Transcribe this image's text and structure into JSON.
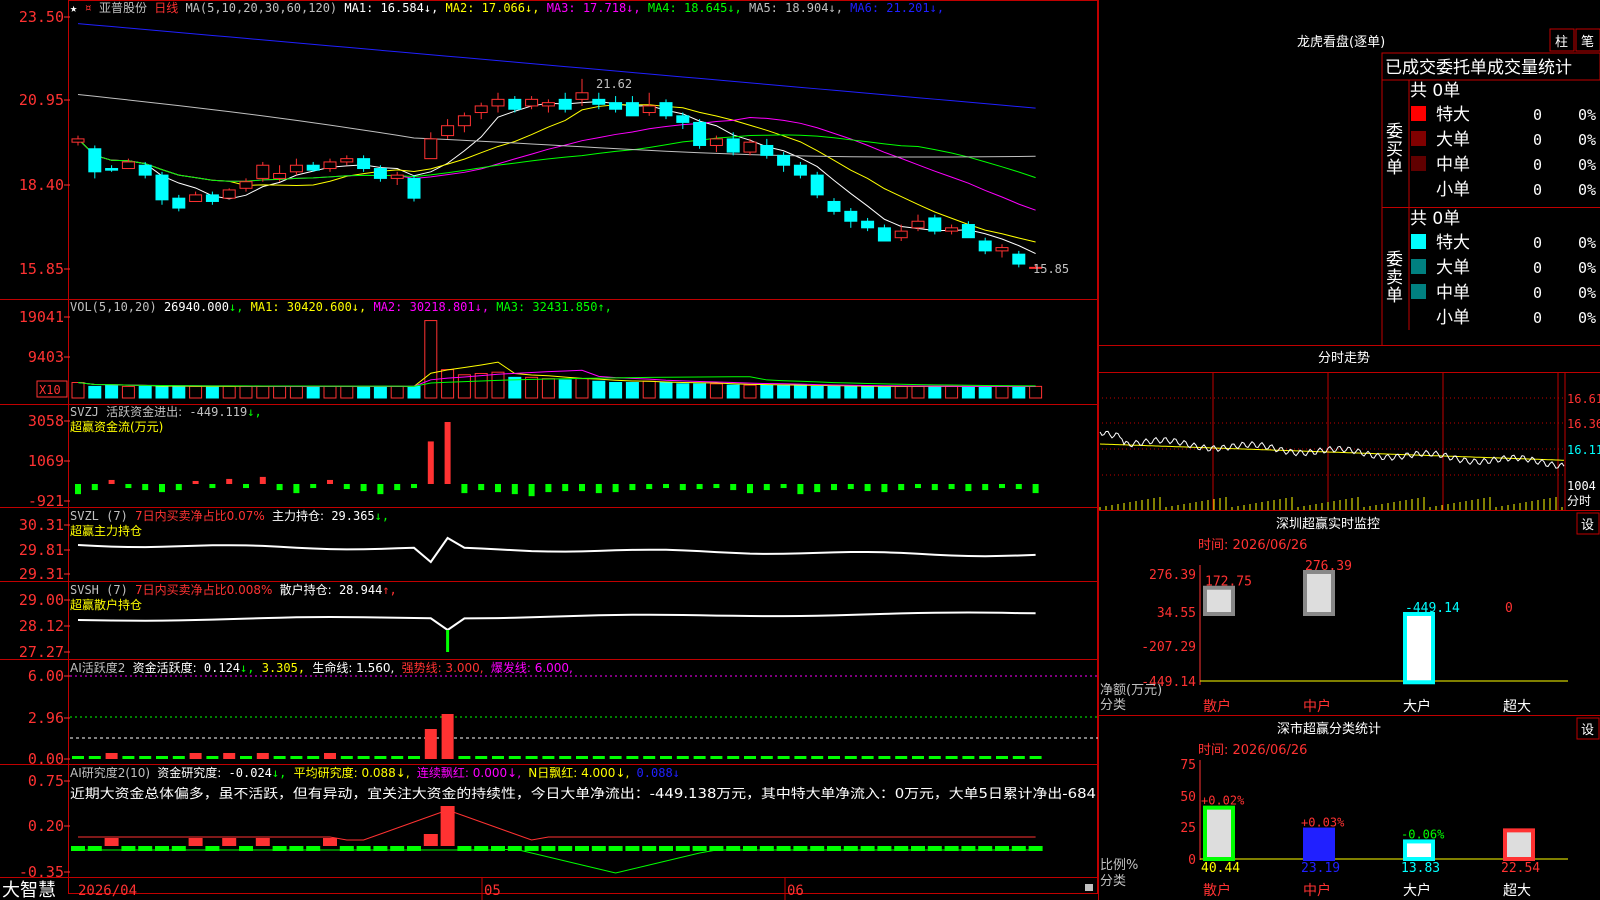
{
  "stock": {
    "name": "亚普股份",
    "period": "日线"
  },
  "main_panel": {
    "ma_header": "MA(5,10,20,30,60,120)",
    "ma_values": [
      {
        "label": "MA1:",
        "value": "16.584",
        "arrow": "↓",
        "color": "#ffffff"
      },
      {
        "label": "MA2:",
        "value": "17.066",
        "arrow": "↓",
        "color": "#ffff00"
      },
      {
        "label": "MA3:",
        "value": "17.718",
        "arrow": "↓",
        "color": "#ff00ff"
      },
      {
        "label": "MA4:",
        "value": "18.645",
        "arrow": "↓",
        "color": "#00ff00"
      },
      {
        "label": "MA5:",
        "value": "18.904",
        "arrow": "↓",
        "color": "#c0c0c0"
      },
      {
        "label": "MA6:",
        "value": "21.201",
        "arrow": "↓",
        "color": "#2020ff"
      }
    ],
    "y_ticks": [
      "23.50",
      "20.95",
      "18.40",
      "15.85"
    ],
    "high_label": "21.62",
    "low_label": "15.85"
  },
  "vol_panel": {
    "header": "VOL(5,10,20)",
    "value": "26940.000",
    "ma": [
      {
        "label": "MA1:",
        "value": "30420.600",
        "arrow": "↓",
        "color": "#ffff00"
      },
      {
        "label": "MA2:",
        "value": "30218.801",
        "arrow": "↓",
        "color": "#ff00ff"
      },
      {
        "label": "MA3:",
        "value": "32431.850",
        "arrow": "↑",
        "color": "#00ff00"
      }
    ],
    "y_ticks": [
      "19041",
      "9403"
    ],
    "unit": "X10"
  },
  "svzj": {
    "name": "SVZJ",
    "label": "活跃资金进出:",
    "value": "-449.119",
    "arrow": "↓,",
    "subtitle": "超赢资金流(万元)",
    "y_ticks": [
      "3058",
      "1069",
      "-921"
    ]
  },
  "svzl": {
    "name": "SVZL (7)",
    "ratio": "7日内买卖净占比0.07%",
    "label": "主力持仓:",
    "value": "29.365",
    "arrow": "↓,",
    "subtitle": "超赢主力持仓",
    "y_ticks": [
      "30.31",
      "29.81",
      "29.31"
    ]
  },
  "svsh": {
    "name": "SVSH (7)",
    "ratio": "7日内买卖净占比0.008%",
    "label": "散户持仓:",
    "value": "28.944",
    "arrow": "↑,",
    "subtitle": "超赢散户持仓",
    "y_ticks": [
      "29.00",
      "28.12",
      "27.27"
    ]
  },
  "ai_active": {
    "name": "AI活跃度2",
    "label": "资金活跃度:",
    "value": "0.124",
    "arrow": "↓,",
    "v2": "3.305,",
    "life": "生命线: 1.560,",
    "strong": "强势线: 3.000,",
    "burst": "爆发线: 6.000,",
    "y_ticks": [
      "6.00",
      "2.96",
      "0.00"
    ]
  },
  "ai_research": {
    "name": "AI研究度2(10)",
    "label": "资金研究度:",
    "value": "-0.024",
    "arrow": "↓,",
    "avg": "平均研究度: 0.088↓,",
    "red": "连续飘红: 0.000↓,",
    "nred": "N日飘红: 4.000↓,",
    "last": "0.088↓",
    "comment": "近期大资金总体偏多，虽不活跃，但有异动，宜关注大资金的持续性，今日大单净流出：-449.138万元，其中特大单净流入：0万元，大单5日累计净出-684",
    "y_ticks": [
      "0.75",
      "0.20",
      "-0.35"
    ]
  },
  "bottom": {
    "brand": "大智慧",
    "date_start": "2026/04",
    "month2": "05",
    "month3": "06"
  },
  "dragon": {
    "title": "龙虎看盘(逐单)",
    "btn1": "柱",
    "btn2": "笔",
    "tabs": "已成交委托单成交量统计",
    "buy": {
      "label": "委买单",
      "total": "共 0单",
      "rows": [
        {
          "name": "特大",
          "count": "0",
          "pct": "0%",
          "color": "#ff0000"
        },
        {
          "name": "大单",
          "count": "0",
          "pct": "0%",
          "color": "#800000"
        },
        {
          "name": "中单",
          "count": "0",
          "pct": "0%",
          "color": "#600000"
        },
        {
          "name": "小单",
          "count": "0",
          "pct": "0%",
          "color": ""
        }
      ]
    },
    "sell": {
      "label": "委卖单",
      "total": "共 0单",
      "rows": [
        {
          "name": "特大",
          "count": "0",
          "pct": "0%",
          "color": "#00ffff"
        },
        {
          "name": "大单",
          "count": "0",
          "pct": "0%",
          "color": "#008080"
        },
        {
          "name": "中单",
          "count": "0",
          "pct": "0%",
          "color": "#008080"
        },
        {
          "name": "小单",
          "count": "0",
          "pct": "0%",
          "color": ""
        }
      ]
    }
  },
  "intraday": {
    "title": "分时走势",
    "prices": [
      "16.61",
      "16.36",
      "16.11"
    ],
    "vol": "1004",
    "vol_label": "分时"
  },
  "monitor": {
    "title": "深圳超赢实时监控",
    "set": "设",
    "time": "时间: 2026/06/26",
    "y_ticks": [
      "276.39",
      "34.55",
      "-207.29",
      "-449.14"
    ],
    "y_unit": "净额(万元)",
    "x_unit": "分类",
    "categories": [
      "散户",
      "中户",
      "大户",
      "超大"
    ],
    "values": [
      172.75,
      276.39,
      -449.14,
      0
    ],
    "value_labels": [
      "172.75",
      "276.39",
      "-449.14",
      "0"
    ]
  },
  "classify": {
    "title": "深市超赢分类统计",
    "set": "设",
    "time": "时间: 2026/06/26",
    "y_ticks": [
      "75",
      "50",
      "25",
      "0"
    ],
    "y_unit": "比例%",
    "x_unit": "分类",
    "categories": [
      "散户",
      "中户",
      "大户",
      "超大"
    ],
    "values": [
      40.44,
      23.19,
      13.83,
      22.54
    ],
    "value_labels": [
      "40.44",
      "23.19",
      "13.83",
      "22.54"
    ],
    "change_labels": [
      "+0.02%",
      "+0.03%",
      "-0.06%",
      ""
    ]
  },
  "colors": {
    "up": "#ff3232",
    "down": "#00ffff",
    "grid": "#c00000",
    "text_red": "#ff3232"
  },
  "chart_data": {
    "type": "candlestick",
    "title": "亚普股份 日线",
    "x_months": [
      "2026/04",
      "05",
      "06"
    ],
    "ylim": [
      15.0,
      23.5
    ],
    "ohlc": [
      [
        19.7,
        19.9,
        19.6,
        19.8
      ],
      [
        19.5,
        19.6,
        18.6,
        18.8
      ],
      [
        18.9,
        19.0,
        18.8,
        18.85
      ],
      [
        18.9,
        19.2,
        18.9,
        19.1
      ],
      [
        19.0,
        19.1,
        18.6,
        18.7
      ],
      [
        18.7,
        18.8,
        17.8,
        17.95
      ],
      [
        18.0,
        18.1,
        17.6,
        17.7
      ],
      [
        17.9,
        18.2,
        17.9,
        18.1
      ],
      [
        18.1,
        18.2,
        17.8,
        17.9
      ],
      [
        18.0,
        18.3,
        18.0,
        18.25
      ],
      [
        18.3,
        18.6,
        18.2,
        18.5
      ],
      [
        18.6,
        19.1,
        18.5,
        19.0
      ],
      [
        18.6,
        19.0,
        18.5,
        18.75
      ],
      [
        18.8,
        19.2,
        18.7,
        19.0
      ],
      [
        19.0,
        19.1,
        18.8,
        18.85
      ],
      [
        18.9,
        19.2,
        18.8,
        19.1
      ],
      [
        19.1,
        19.3,
        19.0,
        19.2
      ],
      [
        19.2,
        19.3,
        18.8,
        18.9
      ],
      [
        18.9,
        19.0,
        18.5,
        18.6
      ],
      [
        18.6,
        18.8,
        18.4,
        18.7
      ],
      [
        18.6,
        18.7,
        17.9,
        18.0
      ],
      [
        19.2,
        20.0,
        19.2,
        19.8
      ],
      [
        19.9,
        20.4,
        19.8,
        20.2
      ],
      [
        20.2,
        20.6,
        20.0,
        20.5
      ],
      [
        20.6,
        20.9,
        20.4,
        20.8
      ],
      [
        20.8,
        21.2,
        20.6,
        21.0
      ],
      [
        21.0,
        21.1,
        20.6,
        20.7
      ],
      [
        20.8,
        21.1,
        20.7,
        21.0
      ],
      [
        20.8,
        21.0,
        20.6,
        20.9
      ],
      [
        21.0,
        21.2,
        20.6,
        20.7
      ],
      [
        21.0,
        21.62,
        20.8,
        21.2
      ],
      [
        21.0,
        21.2,
        20.7,
        20.85
      ],
      [
        20.9,
        21.1,
        20.6,
        20.7
      ],
      [
        20.9,
        21.1,
        20.6,
        20.5
      ],
      [
        20.6,
        21.2,
        20.5,
        20.8
      ],
      [
        20.9,
        21.0,
        20.4,
        20.5
      ],
      [
        20.5,
        20.6,
        20.1,
        20.3
      ],
      [
        20.3,
        20.4,
        19.5,
        19.6
      ],
      [
        19.6,
        19.9,
        19.4,
        19.8
      ],
      [
        19.8,
        20.0,
        19.3,
        19.4
      ],
      [
        19.4,
        19.8,
        19.3,
        19.7
      ],
      [
        19.6,
        19.8,
        19.2,
        19.3
      ],
      [
        19.3,
        19.4,
        18.8,
        19.0
      ],
      [
        19.0,
        19.1,
        18.6,
        18.7
      ],
      [
        18.7,
        18.8,
        18.0,
        18.1
      ],
      [
        17.9,
        18.0,
        17.5,
        17.6
      ],
      [
        17.6,
        17.7,
        17.1,
        17.3
      ],
      [
        17.3,
        17.4,
        17.0,
        17.1
      ],
      [
        17.1,
        17.2,
        16.8,
        16.7
      ],
      [
        16.8,
        17.2,
        16.7,
        17.0
      ],
      [
        17.1,
        17.5,
        17.0,
        17.3
      ],
      [
        17.4,
        17.5,
        16.9,
        17.0
      ],
      [
        17.0,
        17.2,
        16.9,
        17.1
      ],
      [
        17.2,
        17.3,
        16.9,
        16.8
      ],
      [
        16.7,
        16.8,
        16.3,
        16.4
      ],
      [
        16.4,
        16.6,
        16.2,
        16.5
      ],
      [
        16.3,
        16.4,
        15.9,
        16.0
      ],
      [
        15.9,
        16.0,
        15.85,
        15.9
      ]
    ],
    "volume": [
      12,
      9,
      10,
      9,
      9,
      9,
      9,
      9,
      9,
      9,
      9,
      9,
      9,
      9,
      9,
      9,
      9,
      9,
      9,
      9,
      9,
      60,
      22,
      18,
      19,
      20,
      16,
      16,
      15,
      14,
      15,
      13,
      12,
      12,
      13,
      12,
      11,
      11,
      11,
      10,
      10,
      10,
      10,
      10,
      9,
      9,
      9,
      9,
      9,
      9,
      9,
      9,
      9,
      9,
      9,
      9,
      9,
      9
    ],
    "fund_flow": [
      -500,
      -300,
      200,
      -200,
      -300,
      -400,
      -300,
      150,
      -200,
      250,
      -200,
      350,
      -300,
      -450,
      -200,
      200,
      -250,
      -350,
      -500,
      -300,
      -200,
      2100,
      3058,
      -450,
      -300,
      -400,
      -500,
      -600,
      -400,
      -350,
      -350,
      -450,
      -400,
      -300,
      -250,
      -200,
      -300,
      -250,
      -200,
      -300,
      -450,
      -300,
      -200,
      -500,
      -400,
      -300,
      -250,
      -350,
      -400,
      -300,
      -200,
      -300,
      -250,
      -350,
      -300,
      -200,
      -250,
      -449
    ]
  }
}
